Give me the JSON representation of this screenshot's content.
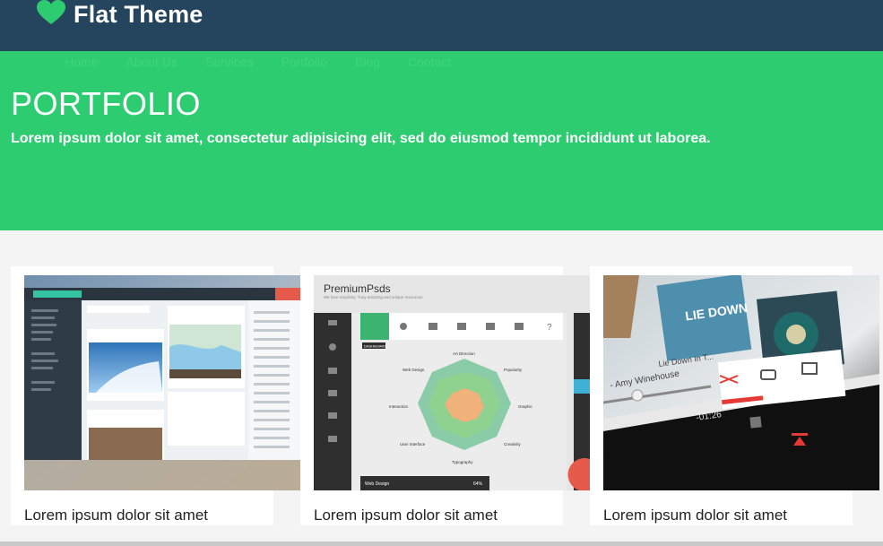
{
  "header": {
    "brand": "Flat Theme"
  },
  "nav": [
    "Home",
    "About Us",
    "Services",
    "Portfolio",
    "Blog",
    "Contact"
  ],
  "hero": {
    "title": "PORTFOLIO",
    "subtitle": "Lorem ipsum dolor sit amet, consectetur adipisicing elit, sed do eiusmod tempor incididunt ut laborea."
  },
  "portfolio": [
    {
      "caption": "Lorem ipsum dolor sit amet"
    },
    {
      "caption": "Lorem ipsum dolor sit amet",
      "brand": "PremiumPsds",
      "tagline": "We love simplicity. Truly amazing and unique resources.",
      "radar_labels": [
        "Art Direction",
        "Popularity",
        "Graphic",
        "Creativity",
        "Typography",
        "User Interface",
        "Interaction",
        "Web Design"
      ],
      "tab_label": "DASHBOARD",
      "bar_label": "Web Design",
      "bar_value": "64%"
    },
    {
      "caption": "Lorem ipsum dolor sit amet",
      "track": "Lie Down In T...",
      "artist": "- Amy Winehouse",
      "time": "-01:26"
    }
  ],
  "colors": {
    "topbar": "#25455f",
    "hero": "#2ecc71",
    "brand_icon": "#2ecc71"
  }
}
